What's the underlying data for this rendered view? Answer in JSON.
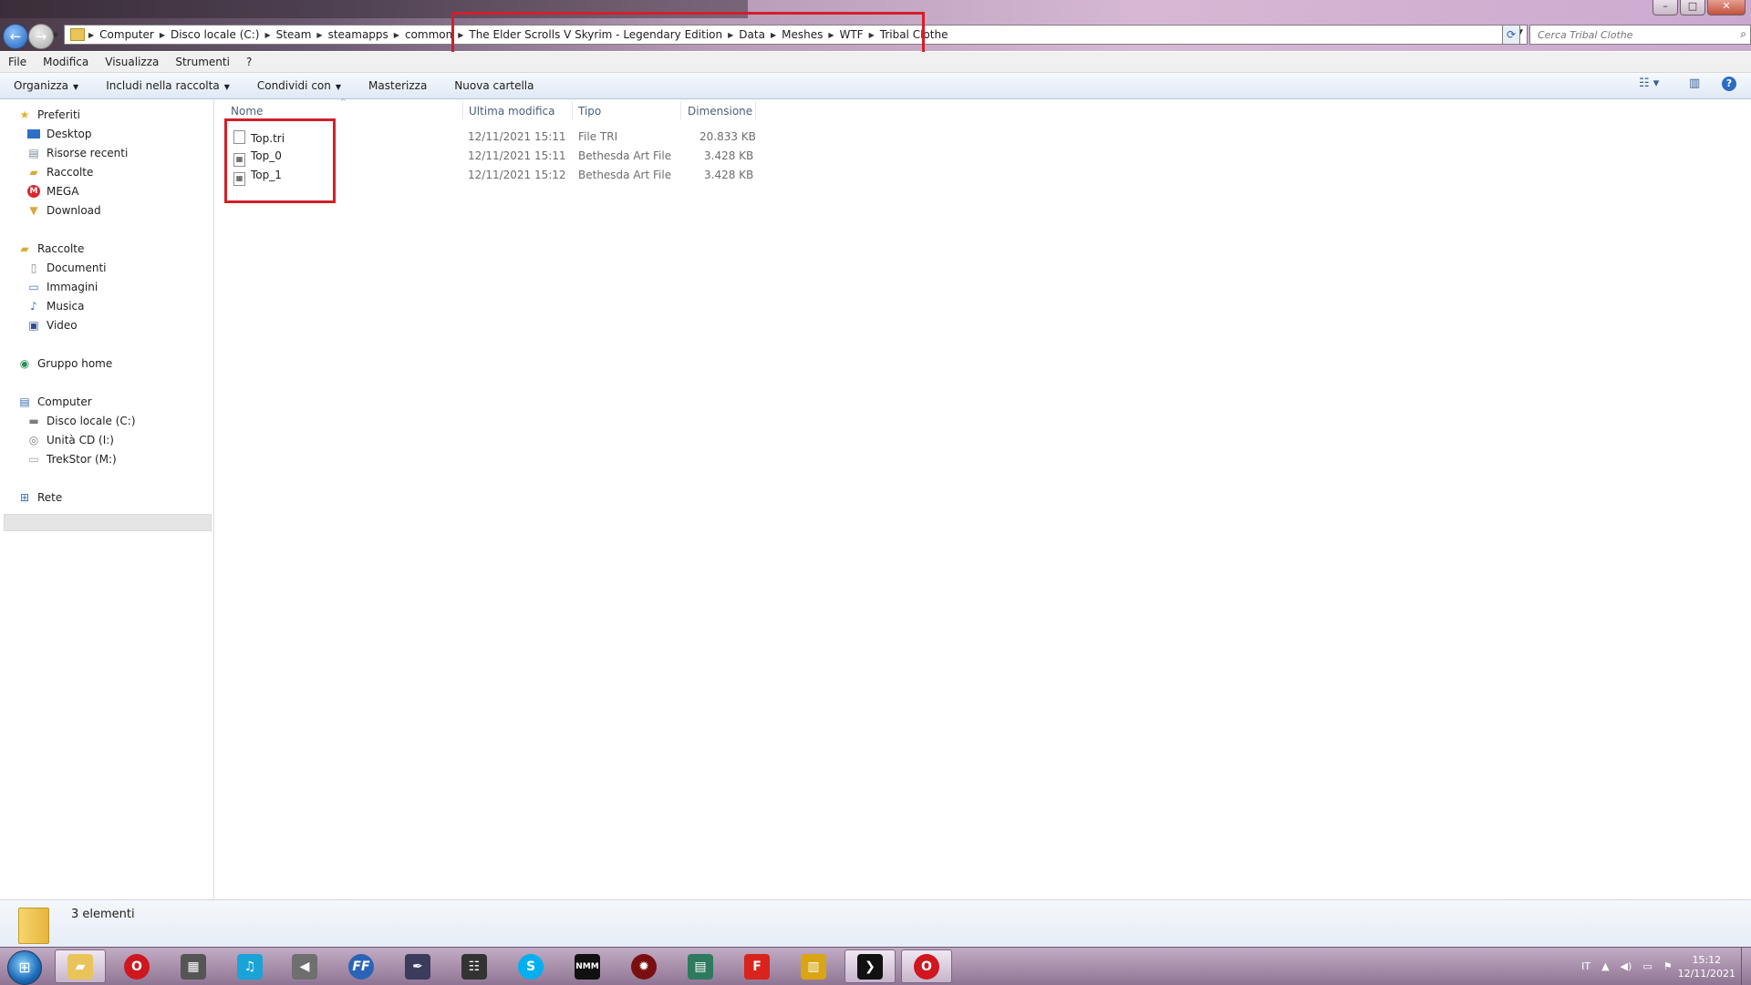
{
  "window": {
    "controls": [
      "–",
      "□",
      "✕"
    ]
  },
  "address": {
    "breadcrumbs": [
      "Computer",
      "Disco locale (C:)",
      "Steam",
      "steamapps",
      "common",
      "The Elder Scrolls V Skyrim - Legendary Edition",
      "Data",
      "Meshes",
      "WTF",
      "Tribal Clothe"
    ],
    "search_placeholder": "Cerca Tribal Clothe"
  },
  "menu": [
    "File",
    "Modifica",
    "Visualizza",
    "Strumenti",
    "?"
  ],
  "commands": {
    "organize": "Organizza",
    "include": "Includi nella raccolta",
    "share": "Condividi con",
    "burn": "Masterizza",
    "new_folder": "Nuova cartella"
  },
  "nav": {
    "favorites": "Preferiti",
    "fav_items": [
      "Desktop",
      "Risorse recenti",
      "Raccolte",
      "MEGA",
      "Download"
    ],
    "libraries": "Raccolte",
    "lib_items": [
      "Documenti",
      "Immagini",
      "Musica",
      "Video"
    ],
    "homegroup": "Gruppo home",
    "computer": "Computer",
    "comp_items": [
      "Disco locale (C:)",
      "Unità CD (I:)",
      "TrekStor (M:)"
    ],
    "network": "Rete"
  },
  "columns": {
    "name": "Nome",
    "modified": "Ultima modifica",
    "type": "Tipo",
    "size": "Dimensione"
  },
  "files": [
    {
      "name": "Top.tri",
      "modified": "12/11/2021 15:11",
      "type": "File TRI",
      "size": "20.833 KB"
    },
    {
      "name": "Top_0",
      "modified": "12/11/2021 15:11",
      "type": "Bethesda Art File",
      "size": "3.428 KB"
    },
    {
      "name": "Top_1",
      "modified": "12/11/2021 15:12",
      "type": "Bethesda Art File",
      "size": "3.428 KB"
    }
  ],
  "status": {
    "count": "3 elementi"
  },
  "taskbar": {
    "ffdec_label": "FF",
    "nmm_label": "NMM",
    "f_label": "F",
    "lang": "IT",
    "time": "15:12",
    "date": "12/11/2021"
  },
  "colors": {
    "highlight": "#d21f2b",
    "accent": "#1d5fb8"
  }
}
